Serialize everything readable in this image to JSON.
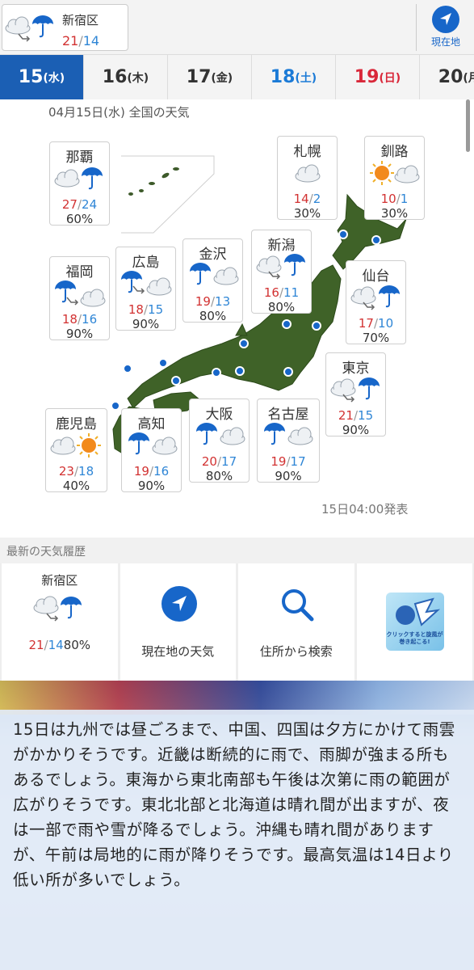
{
  "header": {
    "location_card": {
      "name": "新宿区",
      "high": "21",
      "low": "14",
      "icon": "cloudy-then-rain-icon"
    },
    "current_location_button": {
      "label": "現在地",
      "icon": "location-arrow-icon"
    }
  },
  "tabs": [
    {
      "day": "15",
      "dow": "(水)",
      "active": true
    },
    {
      "day": "16",
      "dow": "(木)"
    },
    {
      "day": "17",
      "dow": "(金)"
    },
    {
      "day": "18",
      "dow": "(土)"
    },
    {
      "day": "19",
      "dow": "(日)"
    },
    {
      "day": "20",
      "dow": "(月)"
    }
  ],
  "map": {
    "title": "04月15日(水) 全国の天気",
    "issued": "15日04:00発表",
    "cities": [
      {
        "name": "那覇",
        "high": "27",
        "low": "24",
        "pop": "60%",
        "icon": "cloudy-then-rain-icon"
      },
      {
        "name": "札幌",
        "high": "14",
        "low": "2",
        "pop": "30%",
        "icon": "cloudy-icon"
      },
      {
        "name": "釧路",
        "high": "10",
        "low": "1",
        "pop": "30%",
        "icon": "sunny-then-cloudy-icon"
      },
      {
        "name": "福岡",
        "high": "18",
        "low": "16",
        "pop": "90%",
        "icon": "rain-then-cloudy-icon"
      },
      {
        "name": "広島",
        "high": "18",
        "low": "15",
        "pop": "90%",
        "icon": "rain-then-cloudy-icon"
      },
      {
        "name": "金沢",
        "high": "19",
        "low": "13",
        "pop": "80%",
        "icon": "rain-then-cloudy-icon"
      },
      {
        "name": "新潟",
        "high": "16",
        "low": "11",
        "pop": "80%",
        "icon": "cloudy-then-rain-icon"
      },
      {
        "name": "仙台",
        "high": "17",
        "low": "10",
        "pop": "70%",
        "icon": "cloudy-then-rain-icon"
      },
      {
        "name": "東京",
        "high": "21",
        "low": "15",
        "pop": "90%",
        "icon": "cloudy-then-rain-icon"
      },
      {
        "name": "鹿児島",
        "high": "23",
        "low": "18",
        "pop": "40%",
        "icon": "cloudy-then-sunny-icon"
      },
      {
        "name": "高知",
        "high": "19",
        "low": "16",
        "pop": "90%",
        "icon": "rain-then-cloudy-icon"
      },
      {
        "name": "大阪",
        "high": "20",
        "low": "17",
        "pop": "80%",
        "icon": "rain-then-cloudy-icon"
      },
      {
        "name": "名古屋",
        "high": "19",
        "low": "17",
        "pop": "90%",
        "icon": "rain-then-cloudy-icon"
      }
    ]
  },
  "history": {
    "title": "最新の天気履歴",
    "location": {
      "name": "新宿区",
      "high": "21",
      "low": "14",
      "pop": "80%",
      "icon": "cloudy-then-rain-icon"
    },
    "current_weather": {
      "label": "現在地の天気",
      "icon": "location-arrow-icon"
    },
    "search_address": {
      "label": "住所から検索",
      "icon": "search-icon"
    },
    "banner": {
      "text": "クリックすると旋風が巻き起こる!",
      "icon": "banner-character-icon"
    }
  },
  "forecast": {
    "text": "15日は九州では昼ごろまで、中国、四国は夕方にかけて雨雲がかかりそうです。近畿は断続的に雨で、雨脚が強まる所もあるでしょう。東海から東北南部も午後は次第に雨の範囲が広がりそうです。東北北部と北海道は晴れ間が出ますが、夜は一部で雨や雪が降るでしょう。沖縄も晴れ間がありますが、午前は局地的に雨が降りそうです。最高気温は14日より低い所が多いでしょう。"
  },
  "colors": {
    "accent": "#1766c9",
    "tab_active": "#1b5fb4",
    "high_temp": "#d23232",
    "low_temp": "#2f86d6",
    "saturday": "#1b7ad6",
    "sunday": "#d9283a"
  }
}
